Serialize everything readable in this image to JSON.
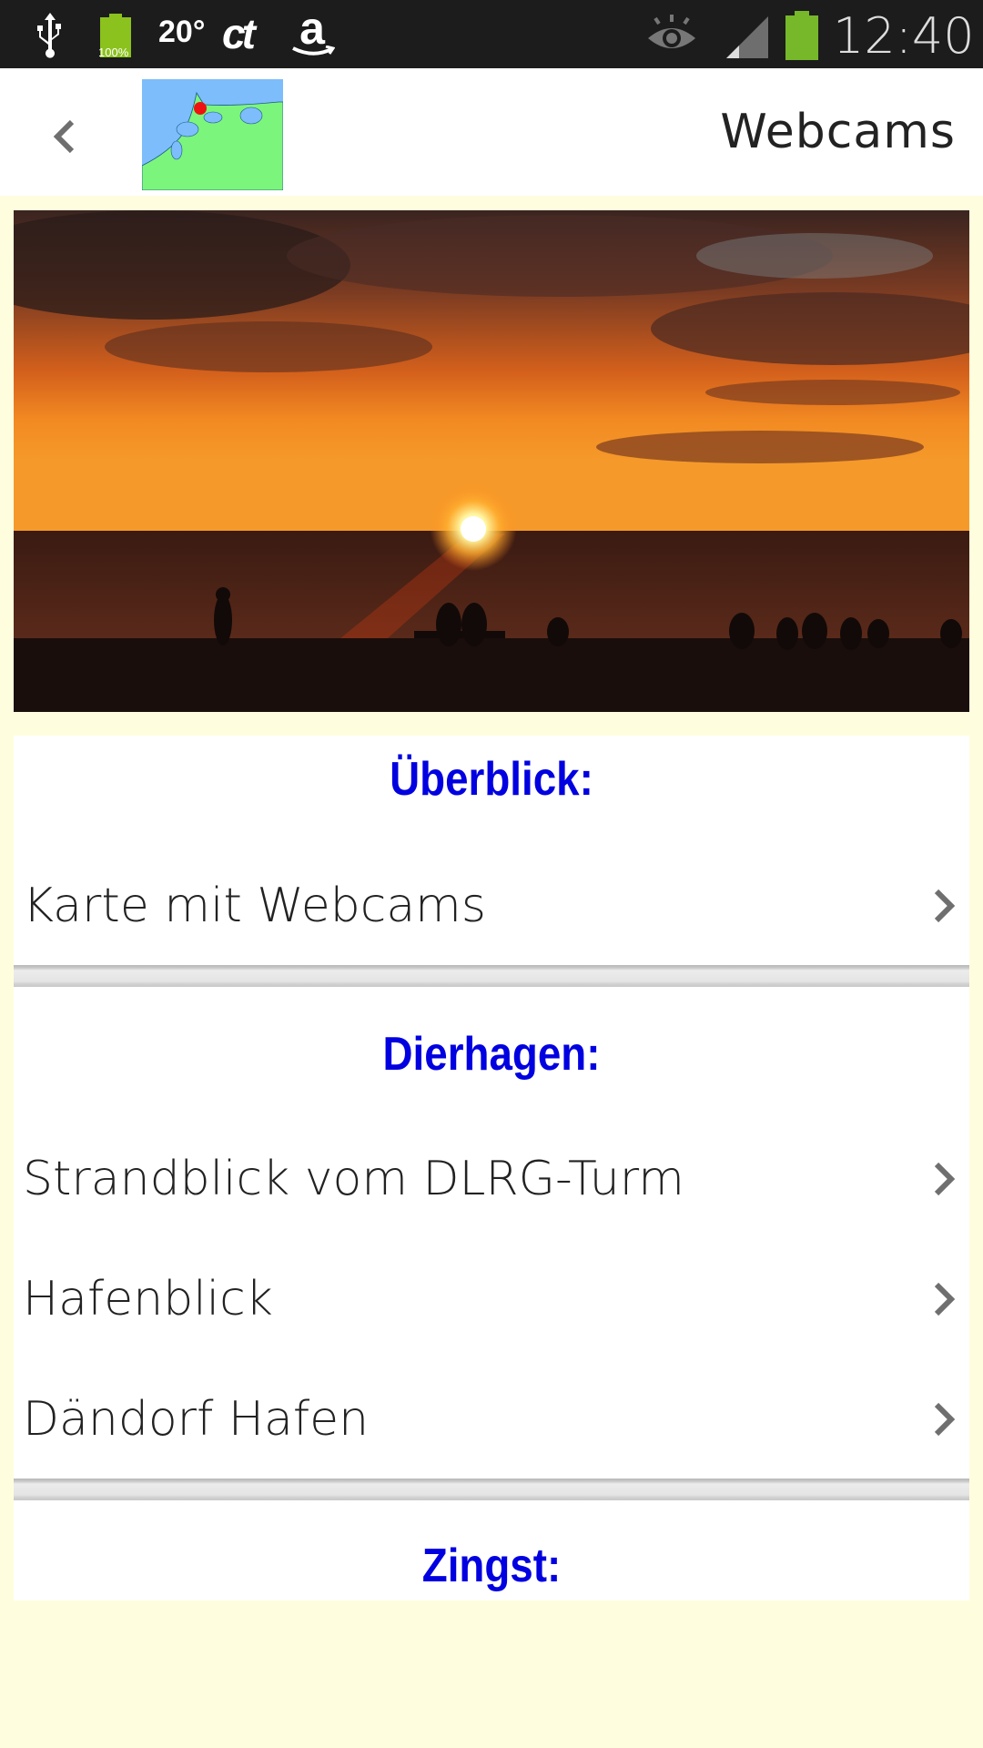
{
  "status_bar": {
    "battery_small_label": "100%",
    "temperature": "20°",
    "ct_label": "ct",
    "amazon_label": "a",
    "time": "12:40",
    "icons": [
      "usb-icon",
      "battery-full-icon",
      "weather-icon",
      "ct-app-icon",
      "amazon-icon",
      "eye-icon",
      "signal-icon",
      "battery-icon"
    ],
    "battery_color": "#76b82a"
  },
  "app_bar": {
    "title": "Webcams",
    "back_icon": "chevron-left-icon",
    "logo": "coast-map-logo"
  },
  "hero": {
    "description": "sunset over the sea with silhouettes on the beach"
  },
  "sections": [
    {
      "header": "Überblick:",
      "items": [
        {
          "label": "Karte mit Webcams"
        }
      ]
    },
    {
      "header": "Dierhagen:",
      "items": [
        {
          "label": "Strandblick vom DLRG-Turm"
        },
        {
          "label": "Hafenblick"
        },
        {
          "label": "Dändorf Hafen"
        }
      ]
    },
    {
      "header": "Zingst:",
      "items": []
    }
  ],
  "colors": {
    "background": "#fefedf",
    "header_text": "#0000e0",
    "item_text": "#222222",
    "chevron": "#6f6f6f"
  }
}
